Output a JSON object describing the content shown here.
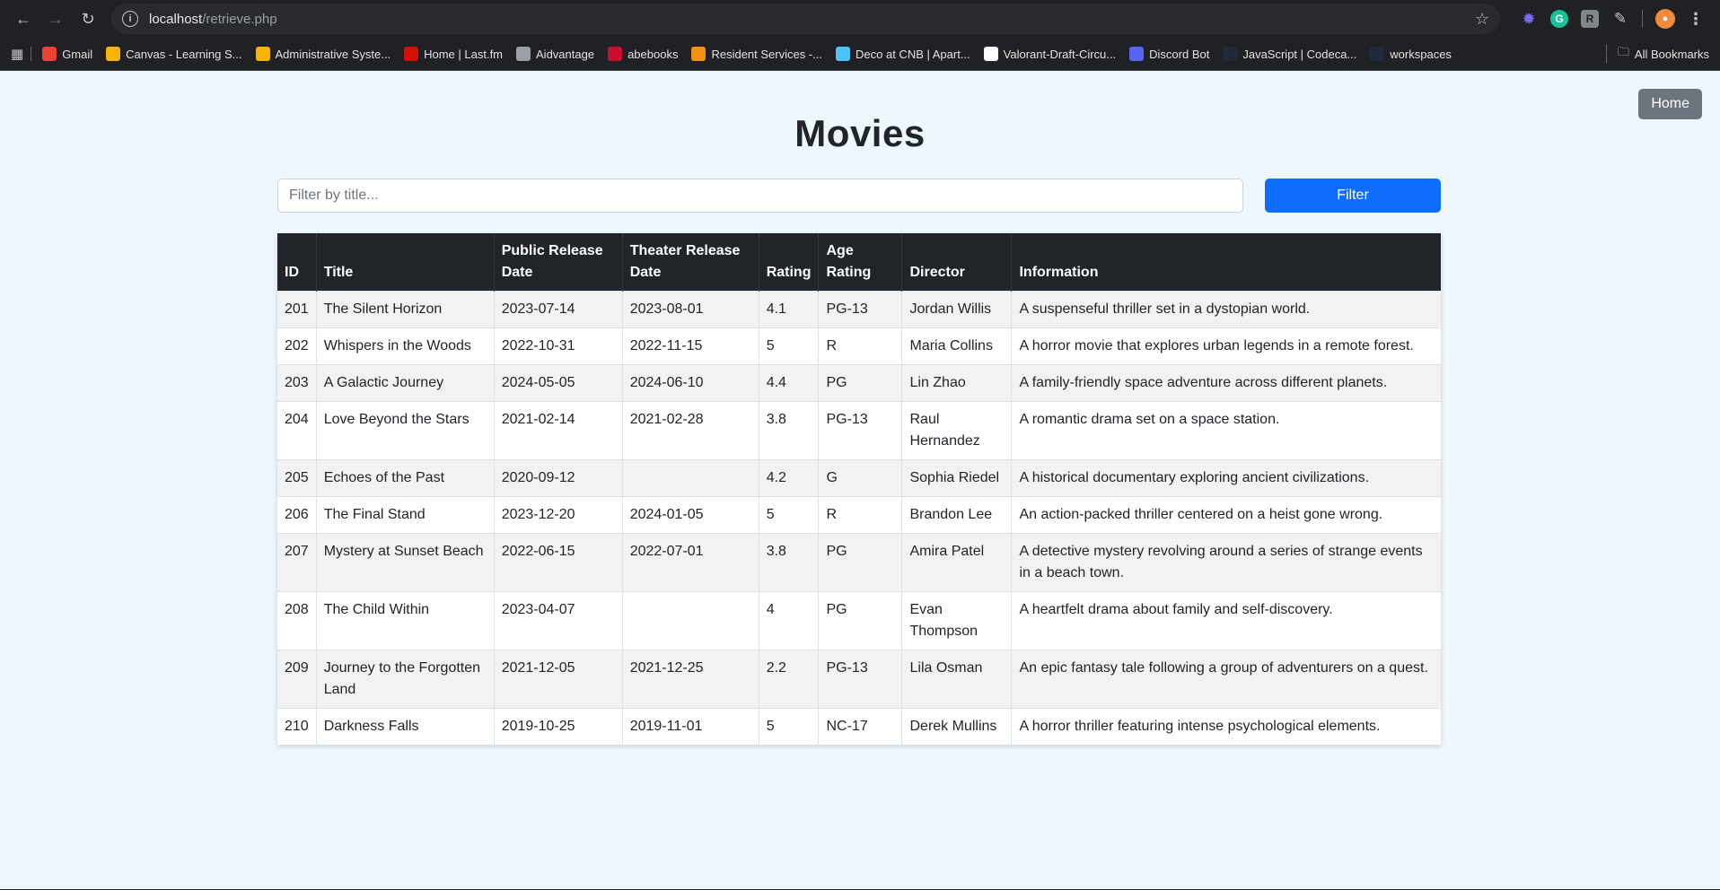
{
  "browser": {
    "url_host": "localhost",
    "url_path": "/retrieve.php",
    "bookmarks": [
      {
        "label": "Gmail",
        "icon": "gmail-icon",
        "color": "#ea4335"
      },
      {
        "label": "Canvas - Learning S...",
        "icon": "vcu-icon",
        "color": "#f8b300"
      },
      {
        "label": "Administrative Syste...",
        "icon": "vcu-icon",
        "color": "#f8b300"
      },
      {
        "label": "Home | Last.fm",
        "icon": "lastfm-icon",
        "color": "#d51007"
      },
      {
        "label": "Aidvantage",
        "icon": "globe-icon",
        "color": "#9aa0a6"
      },
      {
        "label": "abebooks",
        "icon": "abebooks-icon",
        "color": "#c8102e"
      },
      {
        "label": "Resident Services -...",
        "icon": "resident-icon",
        "color": "#f29111"
      },
      {
        "label": "Deco at CNB | Apart...",
        "icon": "deco-icon",
        "color": "#4fc3f7"
      },
      {
        "label": "Valorant-Draft-Circu...",
        "icon": "github-icon",
        "color": "#ffffff"
      },
      {
        "label": "Discord Bot",
        "icon": "discord-icon",
        "color": "#5865f2"
      },
      {
        "label": "JavaScript | Codeca...",
        "icon": "codecademy-icon",
        "color": "#1f2a3a"
      },
      {
        "label": "workspaces",
        "icon": "workspaces-icon",
        "color": "#1f2a3a"
      }
    ],
    "all_bookmarks": "All Bookmarks"
  },
  "page": {
    "home_label": "Home",
    "title": "Movies",
    "filter_placeholder": "Filter by title...",
    "filter_label": "Filter"
  },
  "table": {
    "headers": [
      "ID",
      "Title",
      "Public Release Date",
      "Theater Release Date",
      "Rating",
      "Age Rating",
      "Director",
      "Information"
    ],
    "rows": [
      [
        "201",
        "The Silent Horizon",
        "2023-07-14",
        "2023-08-01",
        "4.1",
        "PG-13",
        "Jordan Willis",
        "A suspenseful thriller set in a dystopian world."
      ],
      [
        "202",
        "Whispers in the Woods",
        "2022-10-31",
        "2022-11-15",
        "5",
        "R",
        "Maria Collins",
        "A horror movie that explores urban legends in a remote forest."
      ],
      [
        "203",
        "A Galactic Journey",
        "2024-05-05",
        "2024-06-10",
        "4.4",
        "PG",
        "Lin Zhao",
        "A family-friendly space adventure across different planets."
      ],
      [
        "204",
        "Love Beyond the Stars",
        "2021-02-14",
        "2021-02-28",
        "3.8",
        "PG-13",
        "Raul Hernandez",
        "A romantic drama set on a space station."
      ],
      [
        "205",
        "Echoes of the Past",
        "2020-09-12",
        "",
        "4.2",
        "G",
        "Sophia Riedel",
        "A historical documentary exploring ancient civilizations."
      ],
      [
        "206",
        "The Final Stand",
        "2023-12-20",
        "2024-01-05",
        "5",
        "R",
        "Brandon Lee",
        "An action-packed thriller centered on a heist gone wrong."
      ],
      [
        "207",
        "Mystery at Sunset Beach",
        "2022-06-15",
        "2022-07-01",
        "3.8",
        "PG",
        "Amira Patel",
        "A detective mystery revolving around a series of strange events in a beach town."
      ],
      [
        "208",
        "The Child Within",
        "2023-04-07",
        "",
        "4",
        "PG",
        "Evan Thompson",
        "A heartfelt drama about family and self-discovery."
      ],
      [
        "209",
        "Journey to the Forgotten Land",
        "2021-12-05",
        "2021-12-25",
        "2.2",
        "PG-13",
        "Lila Osman",
        "An epic fantasy tale following a group of adventurers on a quest."
      ],
      [
        "210",
        "Darkness Falls",
        "2019-10-25",
        "2019-11-01",
        "5",
        "NC-17",
        "Derek Mullins",
        "A horror thriller featuring intense psychological elements."
      ]
    ]
  }
}
